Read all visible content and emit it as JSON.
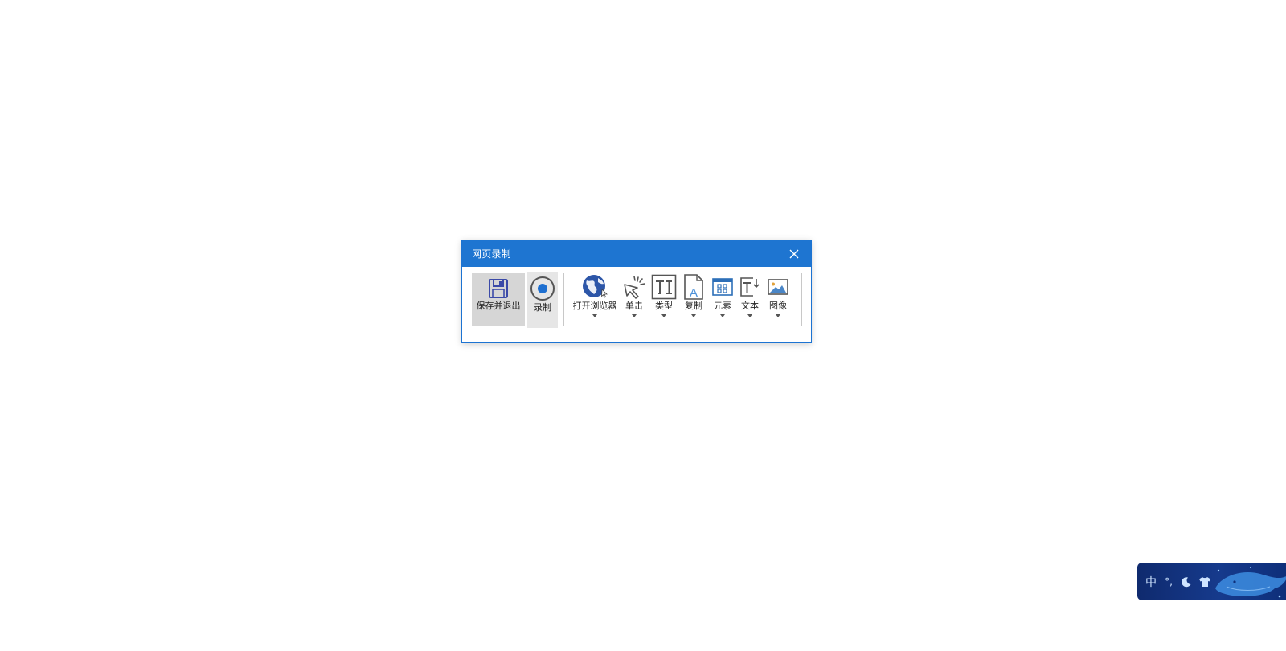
{
  "window": {
    "title": "网页录制"
  },
  "toolbar": {
    "save_exit_label": "保存并退出",
    "record_label": "录制",
    "open_browser_label": "打开浏览器",
    "click_label": "单击",
    "type_label": "类型",
    "copy_label": "复制",
    "element_label": "元素",
    "text_label": "文本",
    "image_label": "图像"
  },
  "ime": {
    "mode_label": "中",
    "punct_label": "°,"
  },
  "colors": {
    "titlebar": "#1e75d1",
    "accent": "#1c73d2",
    "save_bg": "#d6d6d6",
    "record_bg": "#e6e6e6"
  },
  "icons": [
    "floppy-disk-icon",
    "record-icon",
    "globe-icon",
    "cursor-click-icon",
    "type-text-icon",
    "copy-document-icon",
    "element-grid-icon",
    "text-extract-icon",
    "image-icon",
    "close-icon",
    "moon-icon",
    "shirt-icon"
  ]
}
